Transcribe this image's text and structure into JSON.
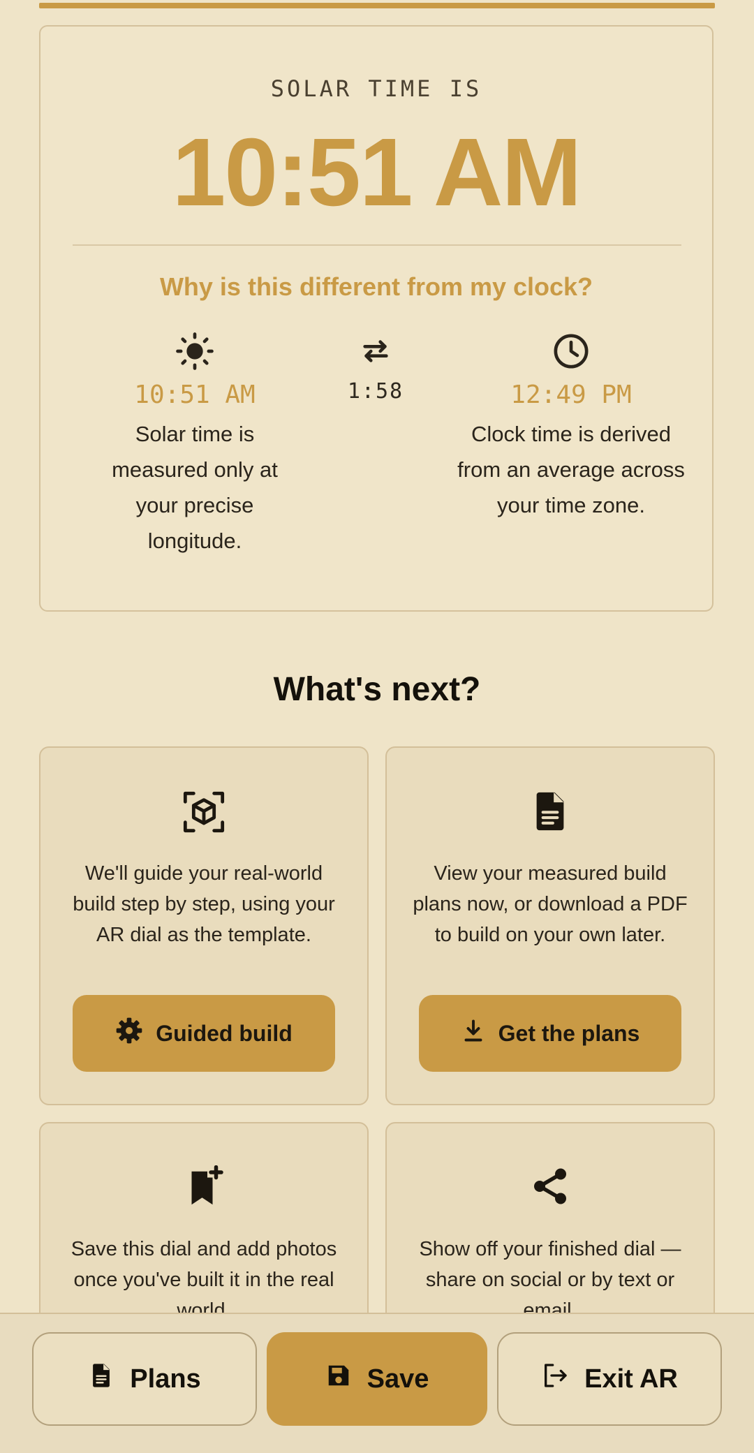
{
  "solar": {
    "label": "SOLAR TIME IS",
    "time": "10:51 AM",
    "why_heading": "Why is this different from my clock?",
    "solar_time": "10:51 AM",
    "solar_desc": "Solar time is measured only at your precise longitude.",
    "difference": "1:58",
    "clock_time": "12:49 PM",
    "clock_desc": "Clock time is derived from an average across your time zone."
  },
  "next": {
    "title": "What's next?",
    "cards": [
      {
        "icon": "ar-cube-icon",
        "text": "We'll guide your real-world build step by step, using your AR dial as the template.",
        "button_label": "Guided build",
        "button_icon": "gear-icon"
      },
      {
        "icon": "document-icon",
        "text": "View your measured build plans now, or download a PDF to build on your own later.",
        "button_label": "Get the plans",
        "button_icon": "download-icon"
      },
      {
        "icon": "bookmark-add-icon",
        "text": "Save this dial and add photos once you've built it in the real world."
      },
      {
        "icon": "share-icon",
        "text": "Show off your finished dial — share on social or by text or email."
      }
    ]
  },
  "bottom_bar": {
    "plans_label": "Plans",
    "save_label": "Save",
    "exit_label": "Exit AR"
  },
  "colors": {
    "background": "#efe4c8",
    "accent": "#c99a45",
    "card": "#e9dcbd",
    "text": "#1c170f"
  }
}
